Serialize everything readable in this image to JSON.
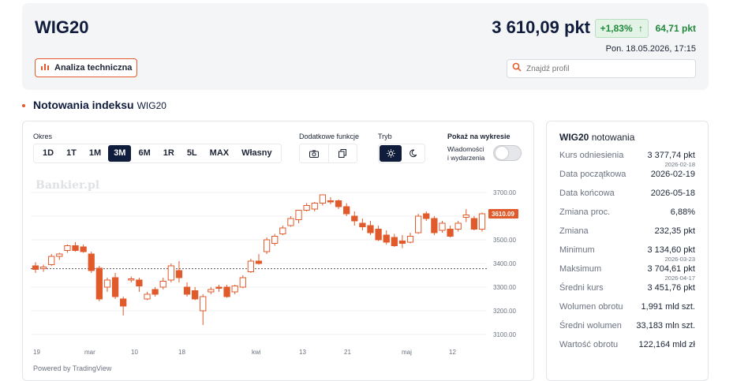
{
  "header": {
    "index_name": "WIG20",
    "price": "3 610,09 pkt",
    "change_pct": "+1,83%",
    "change_abs": "64,71 pkt",
    "timestamp": "Pon. 18.05.2026, 17:15",
    "ta_button": "Analiza techniczna",
    "search_placeholder": "Znajdź profil"
  },
  "section": {
    "title": "Notowania indeksu",
    "subtitle": "WIG20"
  },
  "controls": {
    "period_label": "Okres",
    "periods": [
      "1D",
      "1T",
      "1M",
      "3M",
      "6M",
      "1R",
      "5L",
      "MAX",
      "Własny"
    ],
    "active_period": "3M",
    "extra_label": "Dodatkowe funkcje",
    "mode_label": "Tryb",
    "show_label": "Pokaż na wykresie",
    "events_label_1": "Wiadomości",
    "events_label_2": "i wydarzenia",
    "events_toggle": false
  },
  "chart_data": {
    "type": "candlestick",
    "watermark": "Bankier.pl",
    "x_ticks": [
      "19",
      "mar",
      "10",
      "18",
      "kwi",
      "13",
      "21",
      "maj",
      "12"
    ],
    "y_ticks": [
      "3700.00",
      "3600.00",
      "3500.00",
      "3400.00",
      "3300.00",
      "3200.00",
      "3100.00"
    ],
    "ylim": [
      3100,
      3700
    ],
    "reference_line": 3377.74,
    "last_price_label": "3610.09",
    "last_price": 3610.09,
    "candles": [
      {
        "o": 3390,
        "h": 3405,
        "l": 3360,
        "c": 3375
      },
      {
        "o": 3378,
        "h": 3395,
        "l": 3365,
        "c": 3385
      },
      {
        "o": 3395,
        "h": 3440,
        "l": 3390,
        "c": 3430
      },
      {
        "o": 3430,
        "h": 3445,
        "l": 3415,
        "c": 3440
      },
      {
        "o": 3455,
        "h": 3480,
        "l": 3445,
        "c": 3475
      },
      {
        "o": 3475,
        "h": 3490,
        "l": 3450,
        "c": 3455
      },
      {
        "o": 3470,
        "h": 3480,
        "l": 3445,
        "c": 3450
      },
      {
        "o": 3440,
        "h": 3450,
        "l": 3360,
        "c": 3370
      },
      {
        "o": 3380,
        "h": 3390,
        "l": 3240,
        "c": 3250
      },
      {
        "o": 3300,
        "h": 3340,
        "l": 3280,
        "c": 3330
      },
      {
        "o": 3340,
        "h": 3360,
        "l": 3250,
        "c": 3260
      },
      {
        "o": 3250,
        "h": 3260,
        "l": 3180,
        "c": 3220
      },
      {
        "o": 3330,
        "h": 3345,
        "l": 3320,
        "c": 3335
      },
      {
        "o": 3330,
        "h": 3340,
        "l": 3280,
        "c": 3305
      },
      {
        "o": 3250,
        "h": 3280,
        "l": 3245,
        "c": 3270
      },
      {
        "o": 3290,
        "h": 3300,
        "l": 3260,
        "c": 3270
      },
      {
        "o": 3300,
        "h": 3340,
        "l": 3290,
        "c": 3325
      },
      {
        "o": 3330,
        "h": 3400,
        "l": 3320,
        "c": 3390
      },
      {
        "o": 3370,
        "h": 3410,
        "l": 3320,
        "c": 3340
      },
      {
        "o": 3300,
        "h": 3320,
        "l": 3260,
        "c": 3270
      },
      {
        "o": 3285,
        "h": 3300,
        "l": 3245,
        "c": 3250
      },
      {
        "o": 3200,
        "h": 3270,
        "l": 3140,
        "c": 3260
      },
      {
        "o": 3280,
        "h": 3300,
        "l": 3270,
        "c": 3290
      },
      {
        "o": 3300,
        "h": 3310,
        "l": 3280,
        "c": 3295
      },
      {
        "o": 3300,
        "h": 3310,
        "l": 3255,
        "c": 3260
      },
      {
        "o": 3280,
        "h": 3310,
        "l": 3270,
        "c": 3305
      },
      {
        "o": 3300,
        "h": 3350,
        "l": 3295,
        "c": 3340
      },
      {
        "o": 3365,
        "h": 3420,
        "l": 3360,
        "c": 3410
      },
      {
        "o": 3410,
        "h": 3440,
        "l": 3395,
        "c": 3400
      },
      {
        "o": 3450,
        "h": 3510,
        "l": 3440,
        "c": 3500
      },
      {
        "o": 3485,
        "h": 3525,
        "l": 3475,
        "c": 3515
      },
      {
        "o": 3525,
        "h": 3560,
        "l": 3520,
        "c": 3550
      },
      {
        "o": 3560,
        "h": 3600,
        "l": 3555,
        "c": 3590
      },
      {
        "o": 3585,
        "h": 3610,
        "l": 3570,
        "c": 3625
      },
      {
        "o": 3625,
        "h": 3655,
        "l": 3620,
        "c": 3645
      },
      {
        "o": 3630,
        "h": 3660,
        "l": 3620,
        "c": 3655
      },
      {
        "o": 3655,
        "h": 3690,
        "l": 3645,
        "c": 3690
      },
      {
        "o": 3665,
        "h": 3680,
        "l": 3650,
        "c": 3660
      },
      {
        "o": 3665,
        "h": 3670,
        "l": 3630,
        "c": 3640
      },
      {
        "o": 3640,
        "h": 3655,
        "l": 3600,
        "c": 3610
      },
      {
        "o": 3600,
        "h": 3620,
        "l": 3560,
        "c": 3580
      },
      {
        "o": 3570,
        "h": 3590,
        "l": 3540,
        "c": 3555
      },
      {
        "o": 3560,
        "h": 3580,
        "l": 3520,
        "c": 3530
      },
      {
        "o": 3545,
        "h": 3560,
        "l": 3495,
        "c": 3500
      },
      {
        "o": 3520,
        "h": 3540,
        "l": 3480,
        "c": 3490
      },
      {
        "o": 3510,
        "h": 3525,
        "l": 3470,
        "c": 3475
      },
      {
        "o": 3495,
        "h": 3520,
        "l": 3465,
        "c": 3485
      },
      {
        "o": 3490,
        "h": 3530,
        "l": 3485,
        "c": 3515
      },
      {
        "o": 3530,
        "h": 3610,
        "l": 3525,
        "c": 3600
      },
      {
        "o": 3610,
        "h": 3620,
        "l": 3580,
        "c": 3590
      },
      {
        "o": 3590,
        "h": 3600,
        "l": 3520,
        "c": 3530
      },
      {
        "o": 3540,
        "h": 3580,
        "l": 3530,
        "c": 3570
      },
      {
        "o": 3545,
        "h": 3560,
        "l": 3510,
        "c": 3515
      },
      {
        "o": 3545,
        "h": 3580,
        "l": 3535,
        "c": 3570
      },
      {
        "o": 3595,
        "h": 3630,
        "l": 3575,
        "c": 3605
      },
      {
        "o": 3590,
        "h": 3600,
        "l": 3540,
        "c": 3545
      },
      {
        "o": 3545,
        "h": 3615,
        "l": 3535,
        "c": 3610
      }
    ],
    "up_color": "#ffffff",
    "down_color": "#e05a2b"
  },
  "powered_by": "Powered by TradingView",
  "stats": {
    "title_bold": "WIG20",
    "title_rest": "notowania",
    "rows": [
      {
        "label": "Kurs odniesienia",
        "value": "3 377,74 pkt",
        "sub": "2026-02-18"
      },
      {
        "label": "Data początkowa",
        "value": "2026-02-19",
        "sub": ""
      },
      {
        "label": "Data końcowa",
        "value": "2026-05-18",
        "sub": ""
      },
      {
        "label": "Zmiana proc.",
        "value": "6,88%",
        "sub": ""
      },
      {
        "label": "Zmiana",
        "value": "232,35 pkt",
        "sub": ""
      },
      {
        "label": "Minimum",
        "value": "3 134,60 pkt",
        "sub": "2026-03-23"
      },
      {
        "label": "Maksimum",
        "value": "3 704,61 pkt",
        "sub": "2026-04-17"
      },
      {
        "label": "Średni kurs",
        "value": "3 451,76 pkt",
        "sub": ""
      },
      {
        "label": "Wolumen obrotu",
        "value": "1,991 mld szt.",
        "sub": ""
      },
      {
        "label": "Średni wolumen",
        "value": "33,183 mln szt.",
        "sub": ""
      },
      {
        "label": "Wartość obrotu",
        "value": "122,164 mld zł",
        "sub": ""
      }
    ]
  },
  "colors": {
    "accent": "#e05a2b",
    "positive": "#1f8a3b",
    "navy": "#101c3c"
  }
}
